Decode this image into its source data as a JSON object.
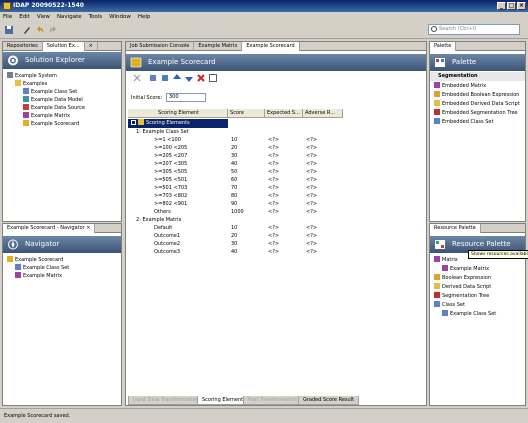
{
  "window": {
    "title": "IDAP 20090522-1540"
  },
  "menu": [
    "File",
    "Edit",
    "View",
    "Navigate",
    "Tools",
    "Window",
    "Help"
  ],
  "search": {
    "placeholder": "Search (Ctrl+I)"
  },
  "left_top": {
    "tabs": [
      "Repositories",
      "Solution Ex...",
      "×"
    ],
    "header": "Solution Explorer",
    "items": [
      "Example System",
      "Examples",
      "Example Class Set",
      "Example Data Model",
      "Example Data Source",
      "Example Matrix",
      "Example Scorecard"
    ]
  },
  "left_bottom": {
    "tab": "Example Scorecard - Navigator ×",
    "header": "Navigator",
    "items": [
      "Example Scorecard",
      "Example Class Set",
      "Example Matrix"
    ]
  },
  "editor": {
    "tabs": [
      "Job Submission Console",
      "Example Matrix",
      "Example Scorecard"
    ],
    "header": "Example Scorecard",
    "initial_score_label": "Initial Score:",
    "initial_score_value": "300",
    "columns": [
      "Scoring Element",
      "Score",
      "Expected S...",
      "Adverse R..."
    ],
    "root_label": "Scoring Elements",
    "rows": [
      {
        "label": "1: Example Class Set",
        "score": "",
        "expected": "",
        "adverse": ""
      },
      {
        "label": ">=1 <100",
        "score": "10",
        "expected": "<?>",
        "adverse": "<?>"
      },
      {
        "label": ">=100 <205",
        "score": "20",
        "expected": "<?>",
        "adverse": "<?>"
      },
      {
        "label": ">=205 <207",
        "score": "30",
        "expected": "<?>",
        "adverse": "<?>"
      },
      {
        "label": ">=207 <305",
        "score": "40",
        "expected": "<?>",
        "adverse": "<?>"
      },
      {
        "label": ">=305 <505",
        "score": "50",
        "expected": "<?>",
        "adverse": "<?>"
      },
      {
        "label": ">=505 <501",
        "score": "60",
        "expected": "<?>",
        "adverse": "<?>"
      },
      {
        "label": ">=501 <703",
        "score": "70",
        "expected": "<?>",
        "adverse": "<?>"
      },
      {
        "label": ">=703 <802",
        "score": "80",
        "expected": "<?>",
        "adverse": "<?>"
      },
      {
        "label": ">=802 <901",
        "score": "90",
        "expected": "<?>",
        "adverse": "<?>"
      },
      {
        "label": "Others",
        "score": "1000",
        "expected": "<?>",
        "adverse": "<?>"
      },
      {
        "label": "2: Example Matrix",
        "score": "",
        "expected": "",
        "adverse": ""
      },
      {
        "label": "Default",
        "score": "10",
        "expected": "<?>",
        "adverse": "<?>"
      },
      {
        "label": "Outcome1",
        "score": "20",
        "expected": "<?>",
        "adverse": "<?>"
      },
      {
        "label": "Outcome2",
        "score": "30",
        "expected": "<?>",
        "adverse": "<?>"
      },
      {
        "label": "Outcome3",
        "score": "40",
        "expected": "<?>",
        "adverse": "<?>"
      }
    ],
    "bottom_tabs": [
      "Input Data Transformation",
      "Scoring Elements",
      "Post Transformation",
      "Graded Score Result"
    ]
  },
  "palette": {
    "tab": "Palette",
    "header": "Palette",
    "section": "Segmentation",
    "items": [
      "Embedded Matrix",
      "Embedded Boolean Expression",
      "Embedded Derived Data Script",
      "Embedded Segmentation Tree",
      "Embedded Class Set"
    ]
  },
  "resource_palette": {
    "tab": "Resource Palette",
    "header": "Resource Palette",
    "tooltip": "Shows resources availabl",
    "items": [
      "Matrix",
      "Example Matrix",
      "Boolean Expression",
      "Derived Data Script",
      "Segmentation Tree",
      "Class Set",
      "Example Class Set"
    ]
  },
  "status": {
    "text": "Example Scorecard saved."
  },
  "colors": {
    "header_top": "#6c86a8",
    "header_bottom": "#3c5474",
    "selection": "#0a246a"
  }
}
